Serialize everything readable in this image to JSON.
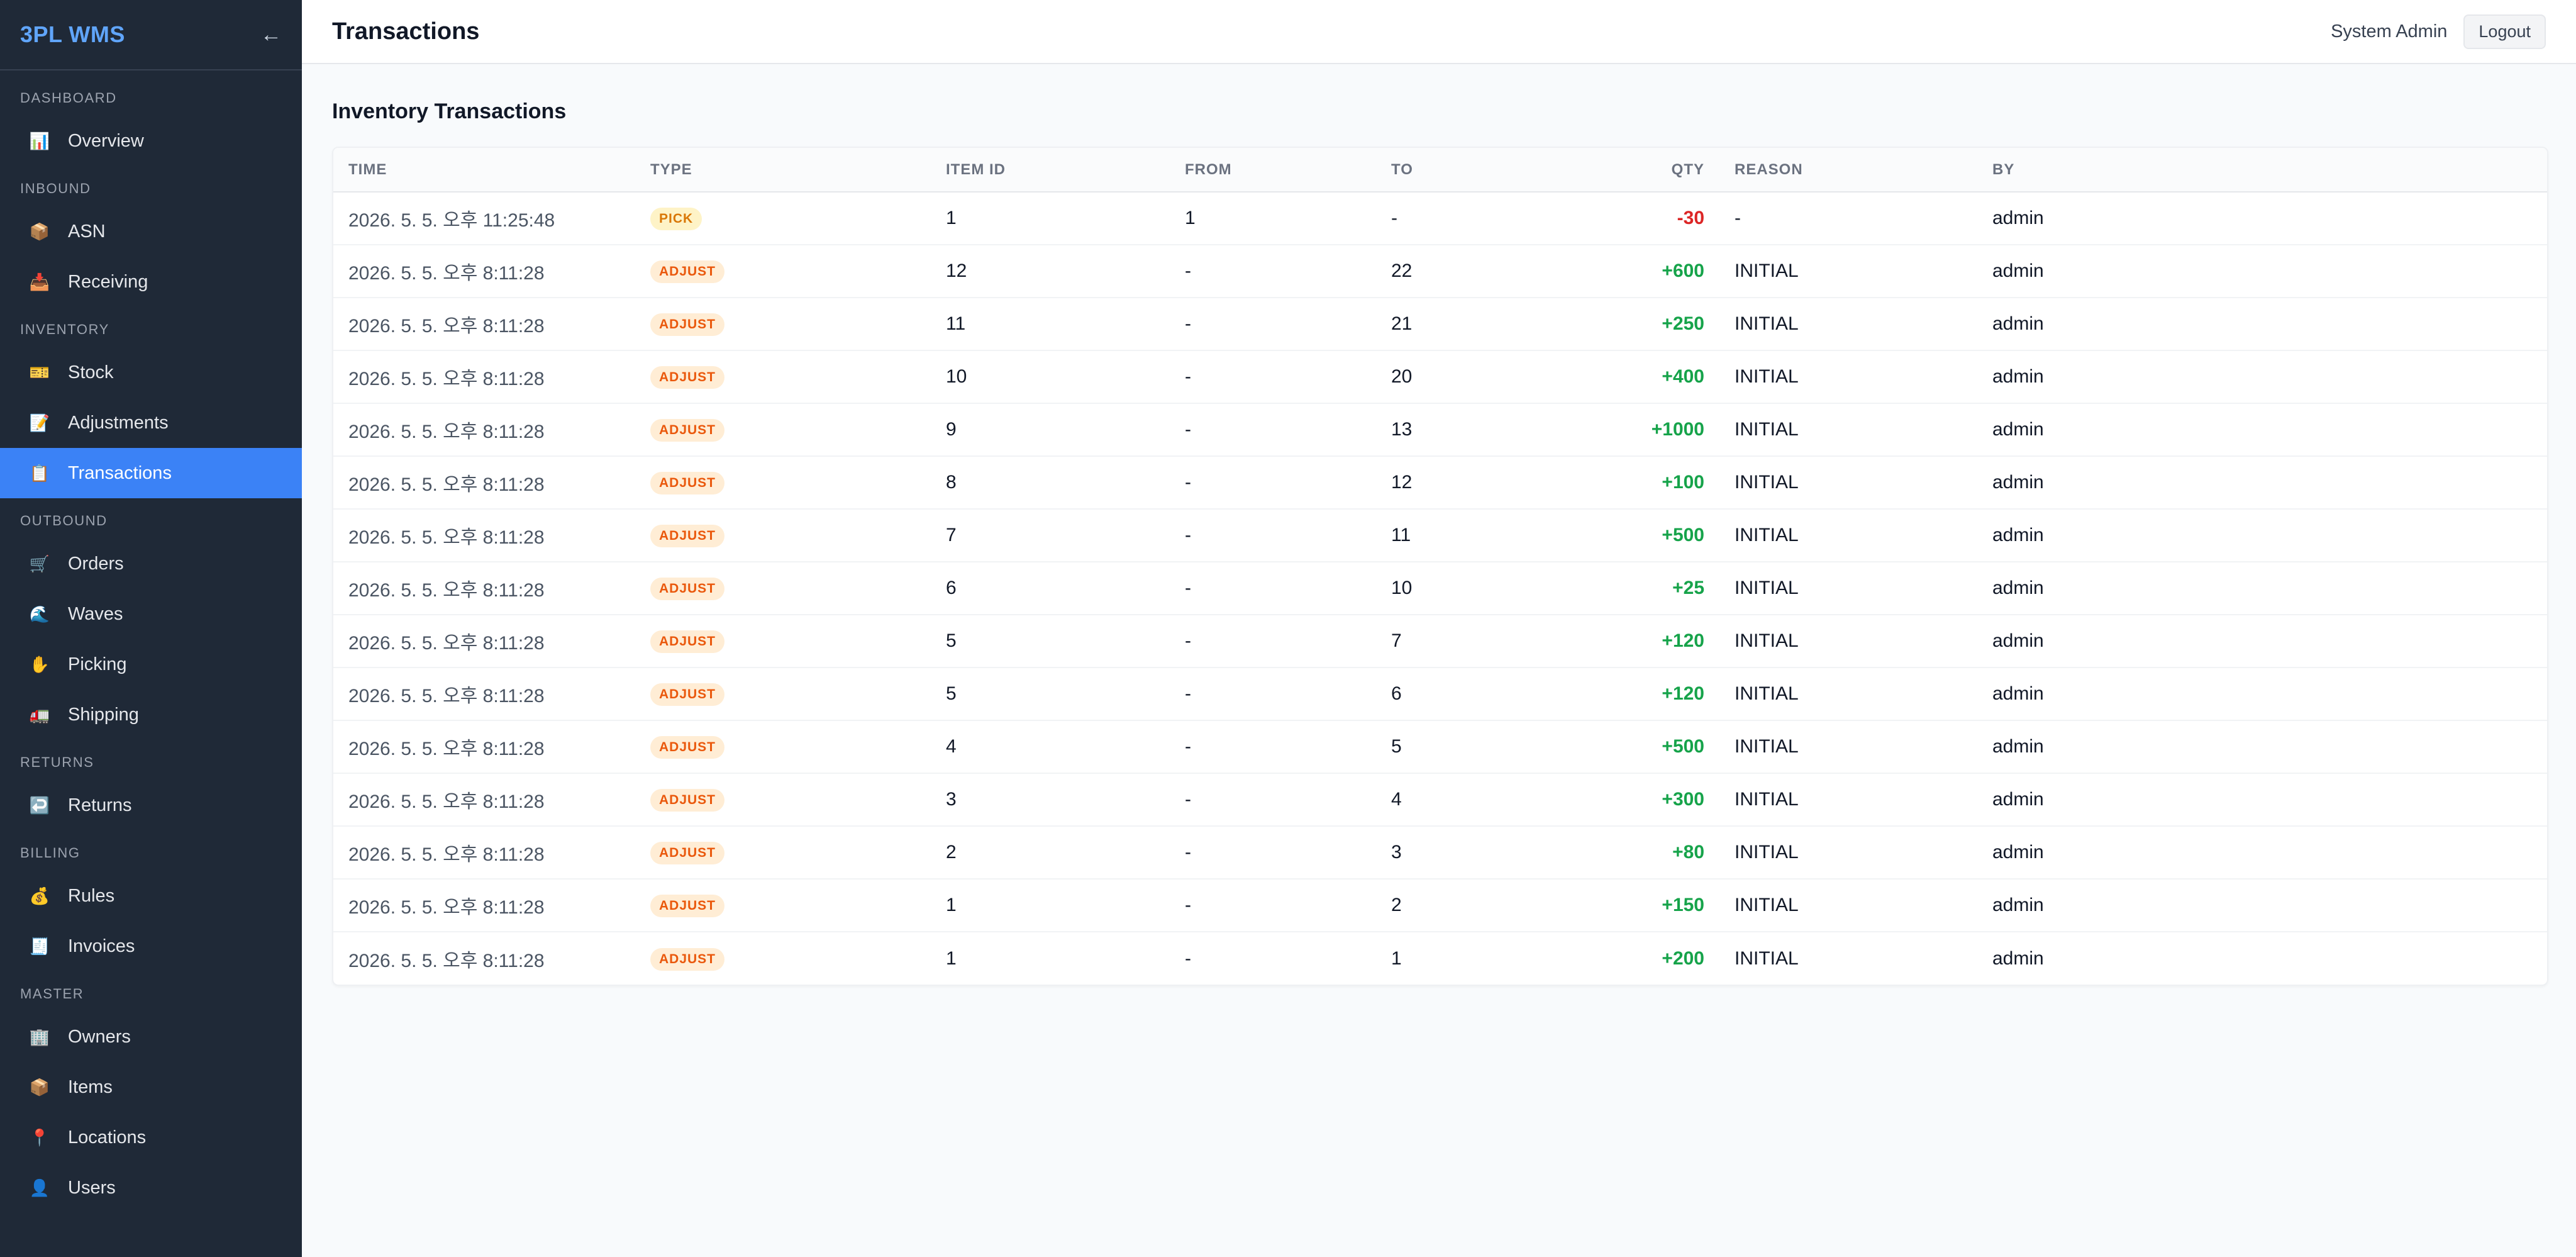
{
  "app": {
    "brand": "3PL WMS",
    "collapse_icon": "arrow-left-icon"
  },
  "sidebar": {
    "sections": [
      {
        "title": "DASHBOARD",
        "items": [
          {
            "label": "Overview",
            "icon": "📊",
            "active": false
          }
        ]
      },
      {
        "title": "INBOUND",
        "items": [
          {
            "label": "ASN",
            "icon": "📦",
            "active": false
          },
          {
            "label": "Receiving",
            "icon": "📥",
            "active": false
          }
        ]
      },
      {
        "title": "INVENTORY",
        "items": [
          {
            "label": "Stock",
            "icon": "🎫",
            "active": false
          },
          {
            "label": "Adjustments",
            "icon": "📝",
            "active": false
          },
          {
            "label": "Transactions",
            "icon": "📋",
            "active": true
          }
        ]
      },
      {
        "title": "OUTBOUND",
        "items": [
          {
            "label": "Orders",
            "icon": "🛒",
            "active": false
          },
          {
            "label": "Waves",
            "icon": "🌊",
            "active": false
          },
          {
            "label": "Picking",
            "icon": "✋",
            "active": false
          },
          {
            "label": "Shipping",
            "icon": "🚛",
            "active": false
          }
        ]
      },
      {
        "title": "RETURNS",
        "items": [
          {
            "label": "Returns",
            "icon": "↩️",
            "active": false
          }
        ]
      },
      {
        "title": "BILLING",
        "items": [
          {
            "label": "Rules",
            "icon": "💰",
            "active": false
          },
          {
            "label": "Invoices",
            "icon": "🧾",
            "active": false
          }
        ]
      },
      {
        "title": "MASTER",
        "items": [
          {
            "label": "Owners",
            "icon": "🏢",
            "active": false
          },
          {
            "label": "Items",
            "icon": "📦",
            "active": false
          },
          {
            "label": "Locations",
            "icon": "📍",
            "active": false
          },
          {
            "label": "Users",
            "icon": "👤",
            "active": false
          }
        ]
      }
    ]
  },
  "header": {
    "title": "Transactions",
    "user": "System Admin",
    "logout_label": "Logout"
  },
  "main": {
    "section_title": "Inventory Transactions",
    "table": {
      "columns": [
        "TIME",
        "TYPE",
        "ITEM ID",
        "FROM",
        "TO",
        "QTY",
        "REASON",
        "BY"
      ],
      "rows": [
        [
          "2026. 5. 5. 오후 11:25:48",
          "PICK",
          "1",
          "1",
          "-",
          "-30",
          "-",
          "admin"
        ],
        [
          "2026. 5. 5. 오후 8:11:28",
          "ADJUST",
          "12",
          "-",
          "22",
          "+600",
          "INITIAL",
          "admin"
        ],
        [
          "2026. 5. 5. 오후 8:11:28",
          "ADJUST",
          "11",
          "-",
          "21",
          "+250",
          "INITIAL",
          "admin"
        ],
        [
          "2026. 5. 5. 오후 8:11:28",
          "ADJUST",
          "10",
          "-",
          "20",
          "+400",
          "INITIAL",
          "admin"
        ],
        [
          "2026. 5. 5. 오후 8:11:28",
          "ADJUST",
          "9",
          "-",
          "13",
          "+1000",
          "INITIAL",
          "admin"
        ],
        [
          "2026. 5. 5. 오후 8:11:28",
          "ADJUST",
          "8",
          "-",
          "12",
          "+100",
          "INITIAL",
          "admin"
        ],
        [
          "2026. 5. 5. 오후 8:11:28",
          "ADJUST",
          "7",
          "-",
          "11",
          "+500",
          "INITIAL",
          "admin"
        ],
        [
          "2026. 5. 5. 오후 8:11:28",
          "ADJUST",
          "6",
          "-",
          "10",
          "+25",
          "INITIAL",
          "admin"
        ],
        [
          "2026. 5. 5. 오후 8:11:28",
          "ADJUST",
          "5",
          "-",
          "7",
          "+120",
          "INITIAL",
          "admin"
        ],
        [
          "2026. 5. 5. 오후 8:11:28",
          "ADJUST",
          "5",
          "-",
          "6",
          "+120",
          "INITIAL",
          "admin"
        ],
        [
          "2026. 5. 5. 오후 8:11:28",
          "ADJUST",
          "4",
          "-",
          "5",
          "+500",
          "INITIAL",
          "admin"
        ],
        [
          "2026. 5. 5. 오후 8:11:28",
          "ADJUST",
          "3",
          "-",
          "4",
          "+300",
          "INITIAL",
          "admin"
        ],
        [
          "2026. 5. 5. 오후 8:11:28",
          "ADJUST",
          "2",
          "-",
          "3",
          "+80",
          "INITIAL",
          "admin"
        ],
        [
          "2026. 5. 5. 오후 8:11:28",
          "ADJUST",
          "1",
          "-",
          "2",
          "+150",
          "INITIAL",
          "admin"
        ],
        [
          "2026. 5. 5. 오후 8:11:28",
          "ADJUST",
          "1",
          "-",
          "1",
          "+200",
          "INITIAL",
          "admin"
        ]
      ]
    }
  },
  "colors": {
    "sidebar_bg": "#1f2937",
    "accent": "#3b82f6",
    "brand": "#60a5fa",
    "qty_positive": "#16a34a",
    "qty_negative": "#dc2626",
    "badge_pick": "#d97706",
    "badge_adjust": "#ea580c"
  }
}
